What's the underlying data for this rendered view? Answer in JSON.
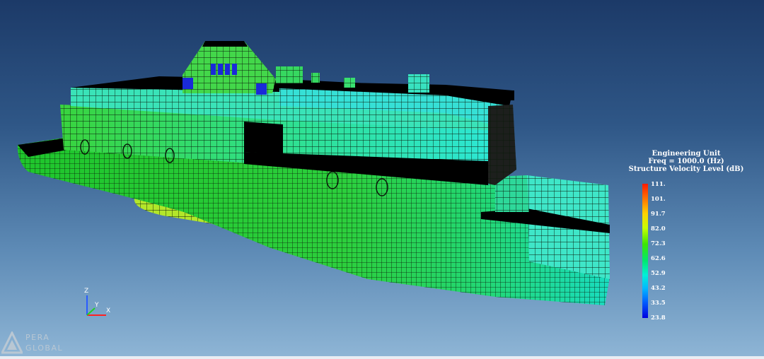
{
  "legend": {
    "title_lines": [
      "Engineering Unit",
      "Freq = 1000.0 (Hz)",
      "Structure Velocity Level (dB)"
    ],
    "ticks": [
      "111.",
      "101.",
      "91.7",
      "82.0",
      "72.3",
      "62.6",
      "52.9",
      "43.2",
      "33.5",
      "23.8"
    ],
    "colors": [
      "#ff1a00",
      "#ff7a00",
      "#ffd000",
      "#c8ff00",
      "#3de600",
      "#00e86a",
      "#00f0d8",
      "#00b8ff",
      "#0060ff",
      "#0000e0"
    ]
  },
  "triad": {
    "z": "Z",
    "y": "Y",
    "x": "X"
  },
  "logo": {
    "line1": "PERA",
    "line2": "GLOBAL"
  },
  "model": {
    "name_icon": "ship-fe-mesh-model",
    "mesh_color": "#0a1a0a",
    "hull_color": "#2fd13e",
    "superstructure_color": "#33e6c8"
  }
}
